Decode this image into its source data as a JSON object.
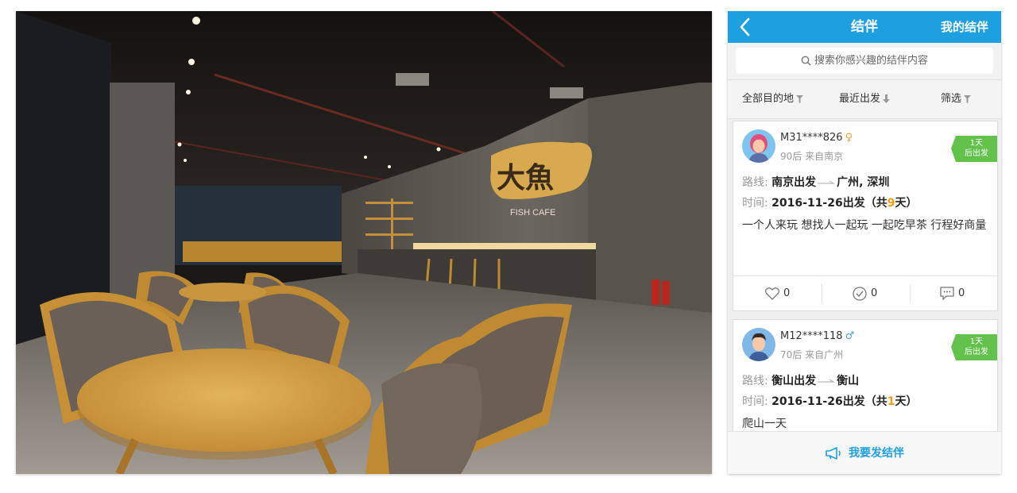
{
  "photo": {
    "sign_main": "大魚",
    "sign_sub": "FISH CAFE"
  },
  "app": {
    "title": "结伴",
    "mine_label": "我的结伴",
    "search_placeholder": "搜索你感兴趣的结伴内容",
    "filters": {
      "destination": "全部目的地",
      "recent": "最近出发",
      "screen": "筛选"
    },
    "labels": {
      "route": "路线:",
      "time": "时间:"
    },
    "posts": [
      {
        "user": "M31****826",
        "gender_symbol": "♀",
        "gender_color": "#f0a030",
        "age": "90后",
        "from": "来自南京",
        "badge_top": "1天",
        "badge_bottom": "后出发",
        "route_start": "南京出发",
        "route_dest": "广州, 深圳",
        "date": "2016-11-26出发",
        "dur_prefix": "（共",
        "dur_num": "9",
        "dur_suffix": "天）",
        "desc": "一个人来玩 想找人一起玩 一起吃早茶 行程好商量",
        "likes": "0",
        "joins": "0",
        "comments": "0"
      },
      {
        "user": "M12****118",
        "gender_symbol": "♂",
        "gender_color": "#4aa3d9",
        "age": "70后",
        "from": "来自广州",
        "badge_top": "1天",
        "badge_bottom": "后出发",
        "route_start": "衡山出发",
        "route_dest": "衡山",
        "date": "2016-11-26出发",
        "dur_prefix": "（共",
        "dur_num": "1",
        "dur_suffix": "天）",
        "desc": "爬山一天"
      }
    ],
    "publish_label": "我要发结伴"
  },
  "colors": {
    "accent": "#1e9fe0",
    "badge": "#63c24c",
    "highlight": "#f39c12"
  }
}
